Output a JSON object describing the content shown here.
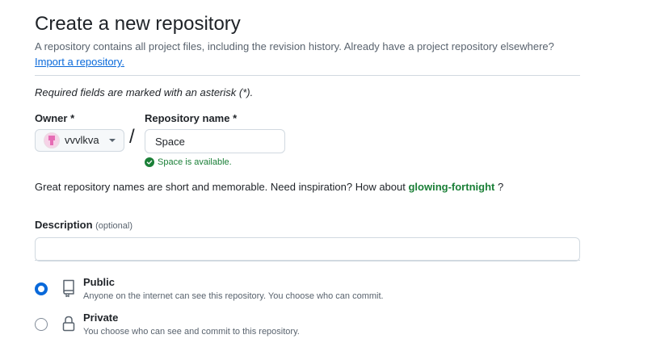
{
  "header": {
    "title": "Create a new repository",
    "subtitle": "A repository contains all project files, including the revision history. Already have a project repository elsewhere?",
    "import_link": "Import a repository."
  },
  "required_note": "Required fields are marked with an asterisk (*).",
  "owner": {
    "label": "Owner *",
    "value": "vvvlkva"
  },
  "repository": {
    "separator": "/",
    "label": "Repository name *",
    "value": "Space",
    "availability": "Space is available."
  },
  "suggestion": {
    "prefix": "Great repository names are short and memorable. Need inspiration? How about",
    "name": "glowing-fortnight",
    "suffix": " ?"
  },
  "description": {
    "label": "Description",
    "optional": "(optional)",
    "value": ""
  },
  "visibility": {
    "selected": "public",
    "options": [
      {
        "title": "Public",
        "description": "Anyone on the internet can see this repository. You choose who can commit.",
        "icon": "repo-icon"
      },
      {
        "title": "Private",
        "description": "You choose who can see and commit to this repository.",
        "icon": "lock-icon"
      }
    ]
  },
  "colors": {
    "link": "#0969da",
    "success": "#1a7f37",
    "radio_checked": "#0969da",
    "border": "#d1d9e0"
  }
}
